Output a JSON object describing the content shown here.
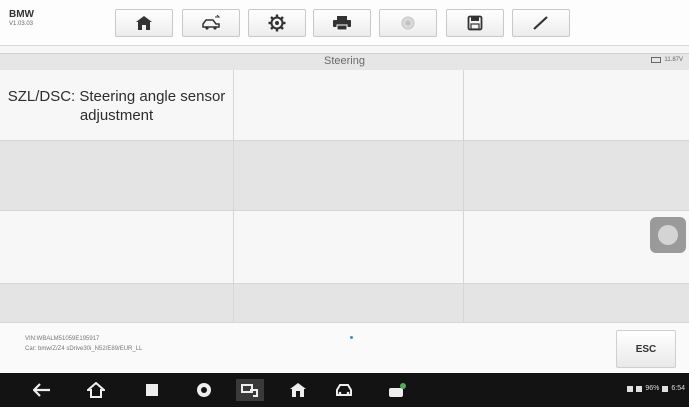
{
  "app": {
    "brand": "BMW",
    "version": "V1.03.03"
  },
  "toolbar": {
    "buttons": [
      {
        "name": "home-button",
        "icon": "home-icon"
      },
      {
        "name": "vehicle-swap-button",
        "icon": "car-swap-icon"
      },
      {
        "name": "settings-button",
        "icon": "gear-icon"
      },
      {
        "name": "print-button",
        "icon": "printer-icon"
      },
      {
        "name": "help-button",
        "icon": "help-icon"
      },
      {
        "name": "save-button",
        "icon": "save-icon"
      },
      {
        "name": "edit-button",
        "icon": "pen-icon"
      }
    ]
  },
  "title": {
    "text": "Steering",
    "battery": "11.87V"
  },
  "grid": {
    "cell_title": "SZL/DSC: Steering angle sensor adjustment"
  },
  "footer": {
    "vin": "VIN:WBALM51059E195917",
    "car": "Car: bmw/Z/Z4 sDrive30i_N52/E89/EUR_LL",
    "esc_label": "ESC"
  },
  "statusbar": {
    "time": "6:54",
    "battery_pct": "96%"
  },
  "nav": {
    "items": [
      "back-icon",
      "home-icon",
      "recents-icon",
      "chrome-icon",
      "screenshot-icon",
      "autel-home-icon",
      "car-icon",
      "vci-icon"
    ]
  }
}
